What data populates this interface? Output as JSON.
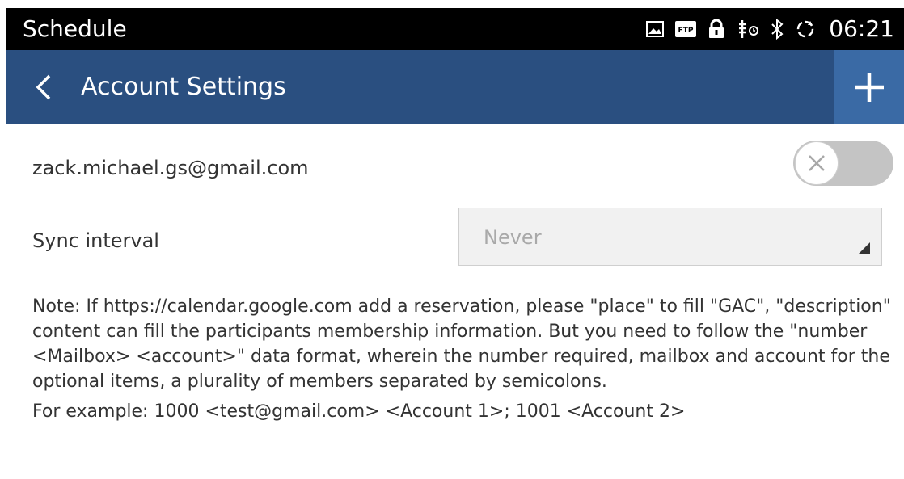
{
  "status_bar": {
    "app_title": "Schedule",
    "time": "06:21",
    "icons": [
      "image-icon",
      "ftp-icon",
      "lock-icon",
      "usb-debug-icon",
      "bluetooth-icon",
      "sync-icon"
    ]
  },
  "toolbar": {
    "title": "Account Settings",
    "background": "#2a4f80"
  },
  "account": {
    "email": "zack.michael.gs@gmail.com",
    "enabled": false
  },
  "sync": {
    "label": "Sync interval",
    "selected": "Never"
  },
  "note": {
    "text": "Note: If https://calendar.google.com add a reservation, please \"place\" to fill \"GAC\", \"description\" content can fill the participants membership information. But you need to follow the \"number <Mailbox> <account>\" data format, wherein the number required, mailbox and account for the optional items, a plurality of members separated by semicolons.",
    "example": "For example: 1000 <test@gmail.com> <Account 1>; 1001 <Account 2>"
  }
}
